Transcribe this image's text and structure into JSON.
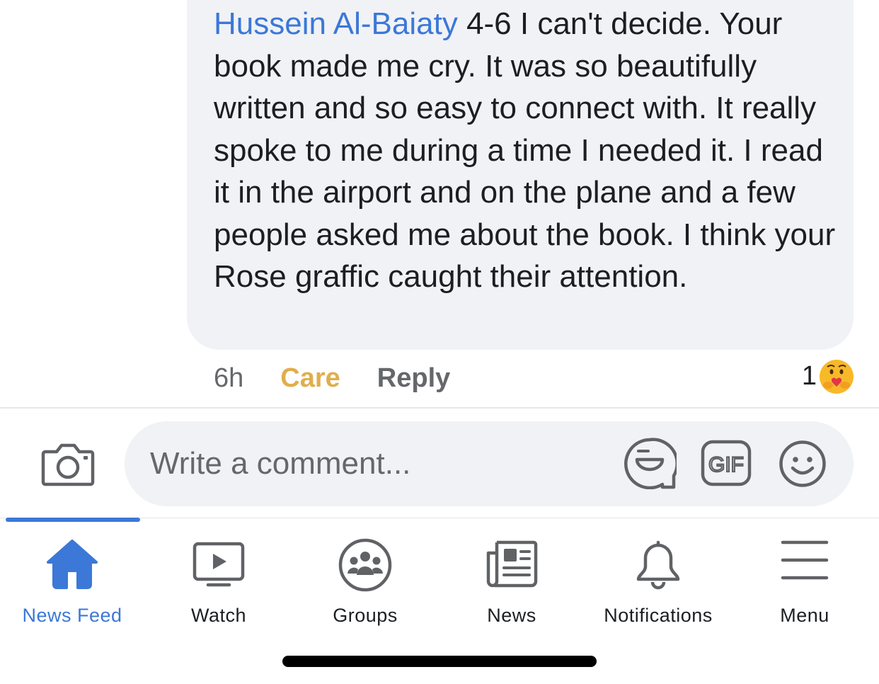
{
  "comment": {
    "author": "Hussein Al-Baiaty",
    "text": "4-6 I can't decide. Your book made me cry. It was so beautifully written and so easy to connect with. It really spoke to me during a time I needed it. I read it in the airport and on the plane and a few people asked me about the book. I think your Rose graffic caught their attention.",
    "time": "6h",
    "reaction_label": "Care",
    "reply_label": "Reply",
    "reaction_count": "1",
    "reaction_icon": "care-emoji-icon"
  },
  "composer": {
    "placeholder": "Write a comment..."
  },
  "tabs": [
    {
      "label": "News Feed",
      "icon": "home-icon",
      "active": true
    },
    {
      "label": "Watch",
      "icon": "watch-icon",
      "active": false
    },
    {
      "label": "Groups",
      "icon": "groups-icon",
      "active": false
    },
    {
      "label": "News",
      "icon": "news-icon",
      "active": false
    },
    {
      "label": "Notifications",
      "icon": "bell-icon",
      "active": false
    },
    {
      "label": "Menu",
      "icon": "menu-icon",
      "active": false
    }
  ],
  "colors": {
    "accent": "#3b78d8",
    "care": "#e0ae4c",
    "bubble": "#f0f2f5",
    "muted": "#65676b"
  }
}
